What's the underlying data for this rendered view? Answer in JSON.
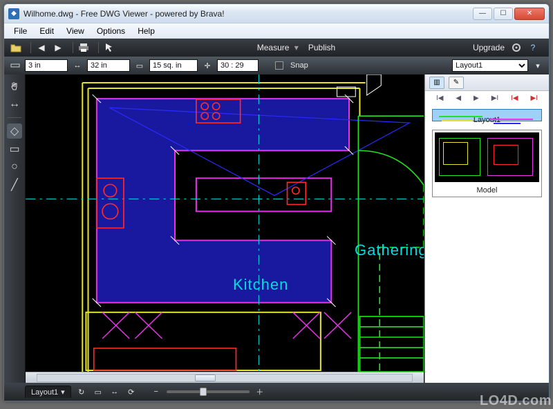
{
  "window": {
    "title": "Wilhome.dwg - Free DWG Viewer - powered by Brava!",
    "min": "—",
    "max": "☐",
    "close": "✕"
  },
  "menu": {
    "items": [
      "File",
      "Edit",
      "View",
      "Options",
      "Help"
    ]
  },
  "toolbar1": {
    "measure": "Measure",
    "publish": "Publish",
    "upgrade": "Upgrade"
  },
  "toolbar2": {
    "v1": "3 in",
    "v2": "32 in",
    "v3": "15 sq. in",
    "v4": "30 : 29",
    "snap_label": "Snap",
    "layouts": [
      "Layout1"
    ],
    "layout_selected": "Layout1"
  },
  "canvas": {
    "labels": {
      "kitchen": "Kitchen",
      "gathering": "Gathering"
    }
  },
  "right": {
    "thumbs": [
      {
        "label": "Layout1",
        "selected": true
      },
      {
        "label": "Model",
        "selected": false
      }
    ]
  },
  "status": {
    "tab": "Layout1"
  },
  "watermark": "LO4D.com",
  "colors": {
    "yellow": "#e4e42a",
    "magenta": "#e433e4",
    "cyan": "#00dddd",
    "green": "#22e222",
    "red": "#ff2a2a",
    "blue": "#1a1aa8",
    "blueline": "#2a2aff",
    "white": "#ffffff"
  }
}
